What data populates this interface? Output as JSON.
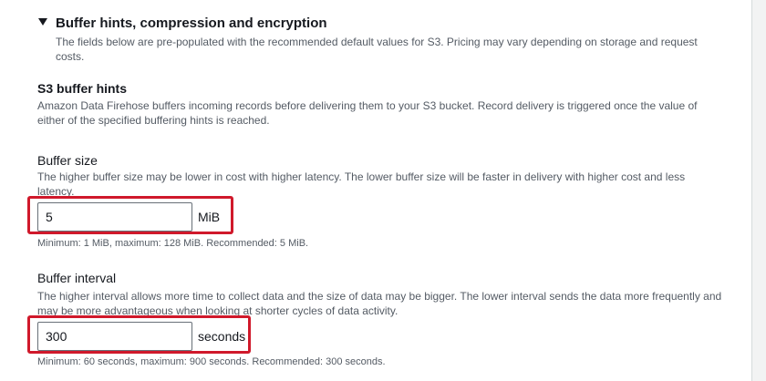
{
  "section": {
    "title": "Buffer hints, compression and encryption",
    "description": "The fields below are pre-populated with the recommended default values for S3. Pricing may vary depending on storage and request costs.",
    "expand_icon": "caret-down-icon"
  },
  "s3_buffer_hints": {
    "heading": "S3 buffer hints",
    "description": "Amazon Data Firehose buffers incoming records before delivering them to your S3 bucket. Record delivery is triggered once the value of either of the specified buffering hints is reached."
  },
  "buffer_size": {
    "label": "Buffer size",
    "description": "The higher buffer size may be lower in cost with higher latency. The lower buffer size will be faster in delivery with higher cost and less latency.",
    "value": "5",
    "unit": "MiB",
    "constraint": "Minimum: 1 MiB, maximum: 128 MiB. Recommended: 5 MiB."
  },
  "buffer_interval": {
    "label": "Buffer interval",
    "description": "The higher interval allows more time to collect data and the size of data may be bigger. The lower interval sends the data more frequently and may be more advantageous when looking at shorter cycles of data activity.",
    "value": "300",
    "unit": "seconds",
    "constraint": "Minimum: 60 seconds, maximum: 900 seconds. Recommended: 300 seconds."
  },
  "colors": {
    "highlight": "#d0192b",
    "text": "#16191f",
    "secondary_text": "#545b64"
  }
}
